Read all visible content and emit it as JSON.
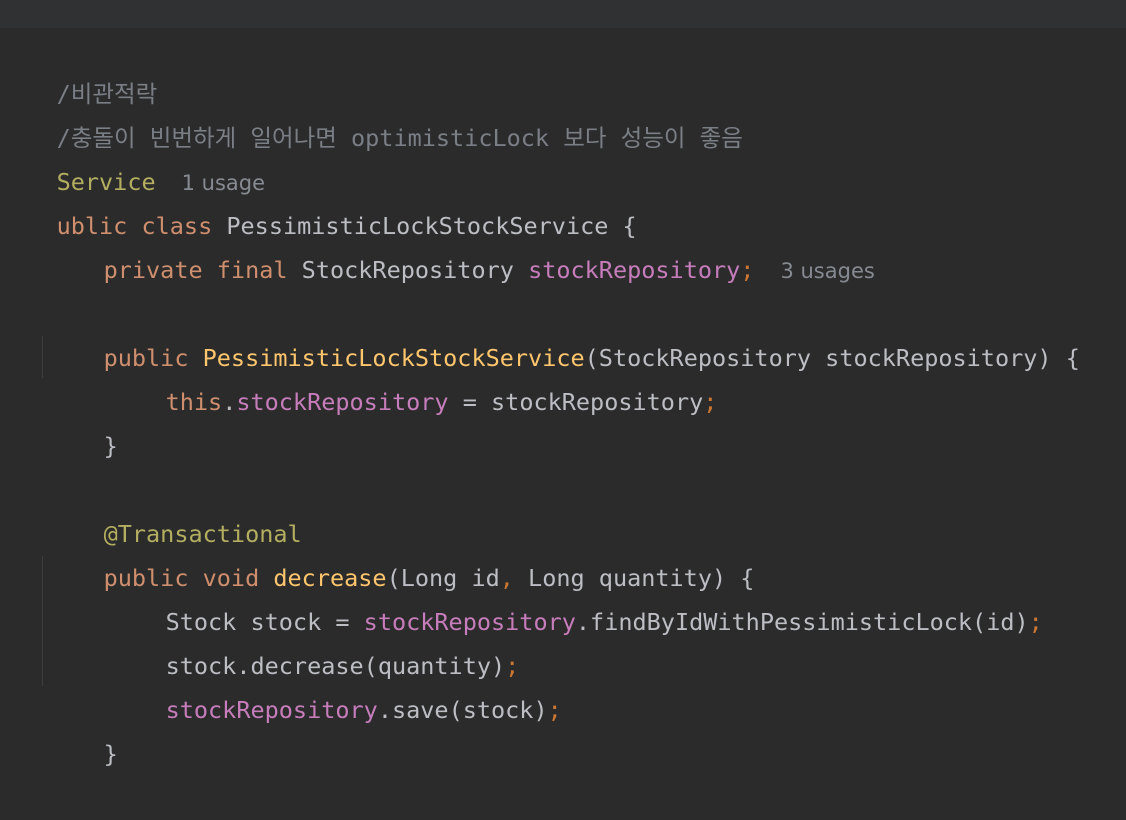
{
  "code": {
    "comment_1": "/비관적락",
    "comment_2": "/충돌이 빈번하게 일어나면 optimisticLock 보다 성능이 좋음",
    "annotation_service": "Service",
    "hint_service": "1 usage",
    "class_decl": {
      "kw": "ublic class",
      "name": " PessimisticLockStockService",
      "brace": " {"
    },
    "field_decl": {
      "kw": "private final",
      "type": " StockRepository ",
      "name": "stockRepository",
      "semi": ";",
      "hint": "3 usages"
    },
    "ctor_decl": {
      "kw": "public ",
      "name": "PessimisticLockStockService",
      "params": "(StockRepository stockRepository) {"
    },
    "ctor_body": {
      "kw": "this",
      "dot": ".",
      "field": "stockRepository",
      "rest": " = stockRepository",
      "semi": ";"
    },
    "ctor_close": "}",
    "annotation_tx": "@Transactional",
    "method_decl": {
      "kw": "public void ",
      "name": "decrease",
      "params_a": "(Long id",
      "comma": ",",
      "params_b": " Long quantity) {"
    },
    "method_line_1": {
      "head": "Stock stock = ",
      "field": "stockRepository",
      "rest": ".findByIdWithPessimisticLock(id)",
      "semi": ";"
    },
    "method_line_2": {
      "text": "stock.decrease(quantity)",
      "semi": ";"
    },
    "method_line_3": {
      "field": "stockRepository",
      "rest": ".save(stock)",
      "semi": ";"
    },
    "method_close": "}"
  }
}
